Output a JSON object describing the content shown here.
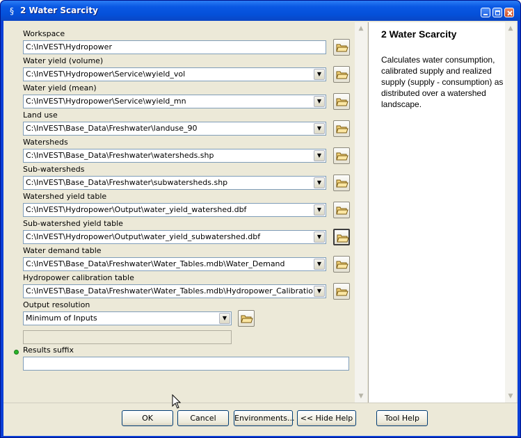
{
  "window": {
    "title": "2 Water Scarcity"
  },
  "params": [
    {
      "label": "Workspace",
      "value": "C:\\InVEST\\Hydropower",
      "kind": "plain"
    },
    {
      "label": "Water yield (volume)",
      "value": "C:\\InVEST\\Hydropower\\Service\\wyield_vol",
      "kind": "combo"
    },
    {
      "label": "Water yield (mean)",
      "value": "C:\\InVEST\\Hydropower\\Service\\wyield_mn",
      "kind": "combo"
    },
    {
      "label": "Land use",
      "value": "C:\\InVEST\\Base_Data\\Freshwater\\landuse_90",
      "kind": "combo"
    },
    {
      "label": "Watersheds",
      "value": "C:\\InVEST\\Base_Data\\Freshwater\\watersheds.shp",
      "kind": "combo"
    },
    {
      "label": "Sub-watersheds",
      "value": "C:\\InVEST\\Base_Data\\Freshwater\\subwatersheds.shp",
      "kind": "combo"
    },
    {
      "label": "Watershed yield table",
      "value": "C:\\InVEST\\Hydropower\\Output\\water_yield_watershed.dbf",
      "kind": "combo"
    },
    {
      "label": "Sub-watershed yield table",
      "value": "C:\\InVEST\\Hydropower\\Output\\water_yield_subwatershed.dbf",
      "kind": "combo"
    },
    {
      "label": "Water demand table",
      "value": "C:\\InVEST\\Base_Data\\Freshwater\\Water_Tables.mdb\\Water_Demand",
      "kind": "combo"
    },
    {
      "label": "Hydropower calibration table",
      "value": "C:\\InVEST\\Base_Data\\Freshwater\\Water_Tables.mdb\\Hydropower_Calibration",
      "kind": "combo"
    }
  ],
  "output_resolution": {
    "label": "Output resolution",
    "value": "Minimum of Inputs"
  },
  "results_suffix": {
    "label": "Results suffix",
    "value": ""
  },
  "help": {
    "title": "2 Water Scarcity",
    "body": "Calculates water consumption, calibrated supply and realized supply (supply - consumption) as distributed over a watershed landscape."
  },
  "buttons": {
    "ok": "OK",
    "cancel": "Cancel",
    "environments": "Environments...",
    "hide_help": "<< Hide Help",
    "tool_help": "Tool Help"
  },
  "icons": {
    "title_icon": "arcgis-tool-icon",
    "browse": "open-folder-icon",
    "dropdown": "chevron-down-icon"
  }
}
